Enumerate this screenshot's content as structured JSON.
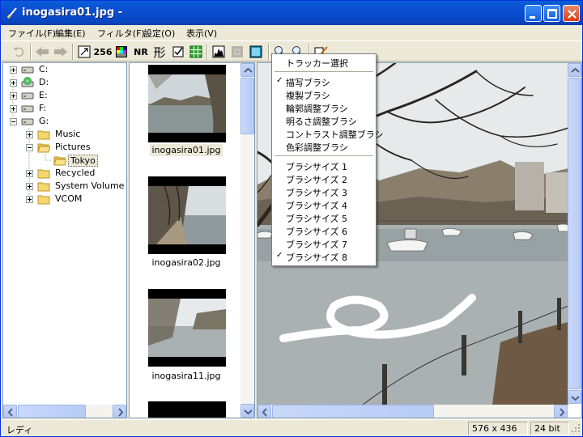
{
  "window": {
    "title": "inogasira01.jpg -"
  },
  "menubar": {
    "items": [
      {
        "label": "ファイル(F)"
      },
      {
        "label": "編集(E)"
      },
      {
        "label": "フィルタ(F)"
      },
      {
        "label": "設定(O)"
      },
      {
        "label": "表示(V)"
      }
    ]
  },
  "toolbar": {
    "colors_256_label": "256",
    "nr_label": "NR",
    "shape_label": "形"
  },
  "tree": {
    "items": [
      {
        "label": "C:",
        "icon": "drive-icon"
      },
      {
        "label": "D:",
        "icon": "cd-drive-icon"
      },
      {
        "label": "E:",
        "icon": "drive-icon"
      },
      {
        "label": "F:",
        "icon": "drive-icon"
      },
      {
        "label": "G:",
        "icon": "drive-icon"
      },
      {
        "label": "Music",
        "icon": "folder-icon"
      },
      {
        "label": "Pictures",
        "icon": "folder-open-icon"
      },
      {
        "label": "Tokyo",
        "icon": "folder-open-icon"
      },
      {
        "label": "Recycled",
        "icon": "folder-icon"
      },
      {
        "label": "System Volume I",
        "icon": "folder-icon"
      },
      {
        "label": "VCOM",
        "icon": "folder-icon"
      }
    ]
  },
  "thumbnails": {
    "items": [
      {
        "filename": "inogasira01.jpg",
        "selected": true
      },
      {
        "filename": "inogasira02.jpg",
        "selected": false
      },
      {
        "filename": "inogasira11.jpg",
        "selected": false
      }
    ]
  },
  "dropdown": {
    "header": "トラッカー選択",
    "tool_items": [
      {
        "label": "描写ブラシ",
        "checked": true
      },
      {
        "label": "複製ブラシ",
        "checked": false
      },
      {
        "label": "輪郭調整ブラシ",
        "checked": false
      },
      {
        "label": "明るさ調整ブラシ",
        "checked": false
      },
      {
        "label": "コントラスト調整ブラシ",
        "checked": false
      },
      {
        "label": "色彩調整ブラシ",
        "checked": false
      }
    ],
    "size_items": [
      {
        "label": "ブラシサイズ 1",
        "checked": false
      },
      {
        "label": "ブラシサイズ 2",
        "checked": false
      },
      {
        "label": "ブラシサイズ 3",
        "checked": false
      },
      {
        "label": "ブラシサイズ 4",
        "checked": false
      },
      {
        "label": "ブラシサイズ 5",
        "checked": false
      },
      {
        "label": "ブラシサイズ 6",
        "checked": false
      },
      {
        "label": "ブラシサイズ 7",
        "checked": false
      },
      {
        "label": "ブラシサイズ 8",
        "checked": true
      }
    ],
    "checkmark": "✓"
  },
  "statusbar": {
    "status_text": "レディ",
    "dimensions": "576 x 436",
    "bit_depth": "24 bit"
  },
  "colors": {
    "title_blue": "#0b4ed2",
    "window_face": "#ece9d8",
    "panel_border": "#7f9db9"
  }
}
